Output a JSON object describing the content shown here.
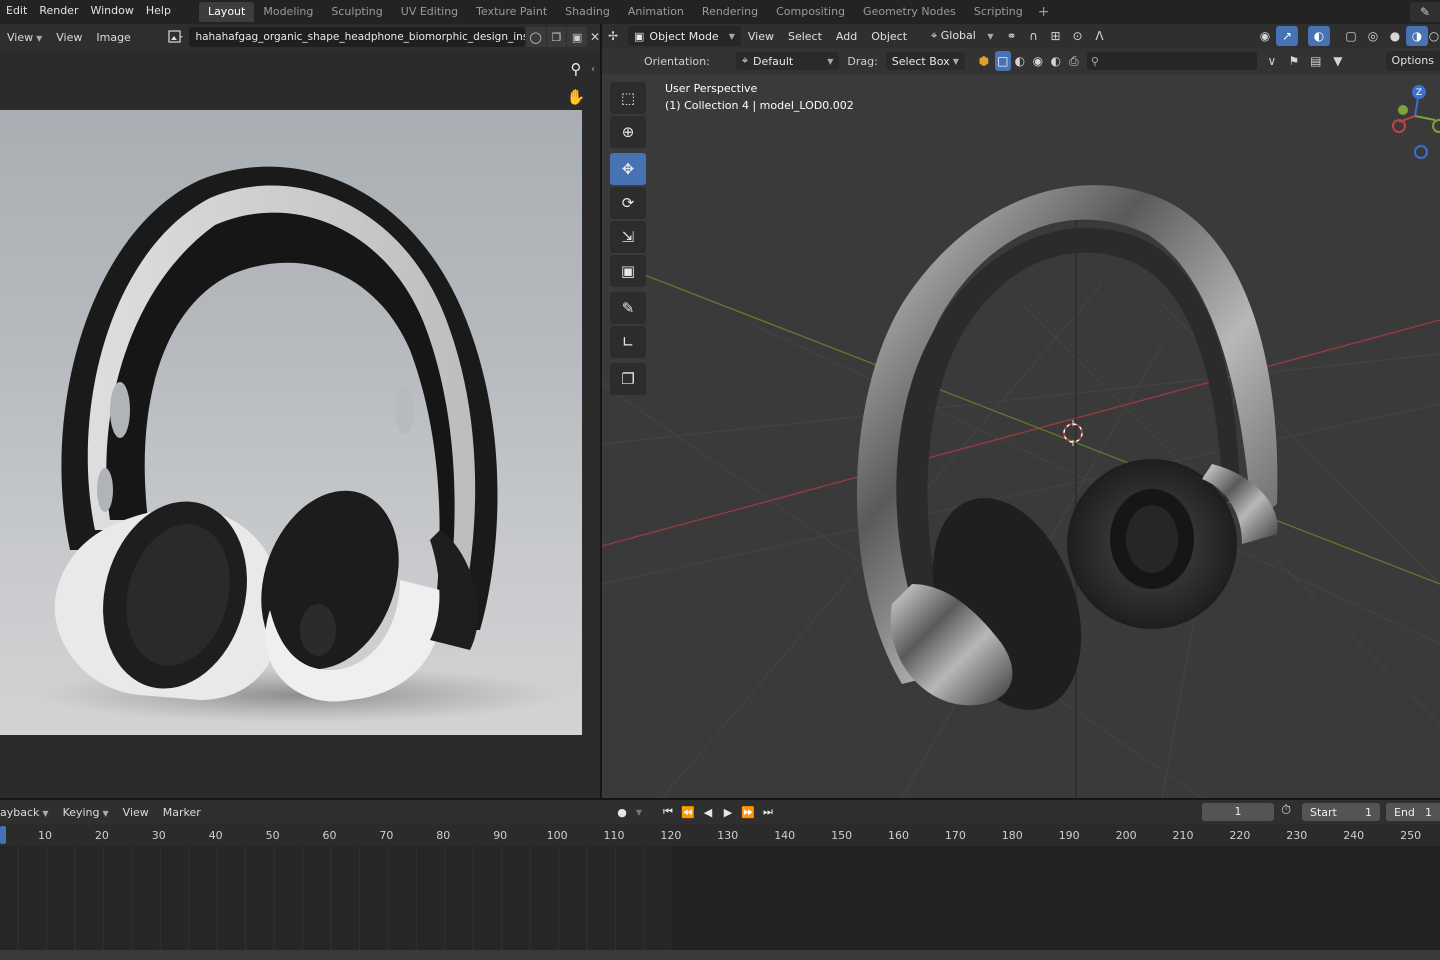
{
  "topbar": {
    "menu": [
      "Edit",
      "Render",
      "Window",
      "Help"
    ],
    "workspaces": [
      "Layout",
      "Modeling",
      "Sculpting",
      "UV Editing",
      "Texture Paint",
      "Shading",
      "Animation",
      "Rendering",
      "Compositing",
      "Geometry Nodes",
      "Scripting"
    ],
    "active_workspace": "Layout",
    "add_label": "+"
  },
  "image_editor": {
    "menus": [
      "View",
      "View",
      "Image"
    ],
    "filename": "hahahafgag_organic_shape_headphone_biomorphic_design_inspired_b"
  },
  "viewport": {
    "mode": "Object Mode",
    "menus": [
      "View",
      "Select",
      "Add",
      "Object"
    ],
    "transform_orientation": "Global",
    "tool_settings": {
      "orientation_label": "Orientation:",
      "orientation_value": "Default",
      "drag_label": "Drag:",
      "drag_value": "Select Box",
      "options_label": "Options"
    },
    "view_name": "User Perspective",
    "collection_info": "(1) Collection 4 | model_LOD0.002",
    "gizmo_axis": "Z"
  },
  "timeline": {
    "menus": [
      "ayback",
      "Keying",
      "View",
      "Marker"
    ],
    "current_frame": "1",
    "start_label": "Start",
    "start_value": "1",
    "end_label": "End",
    "end_value": "1",
    "ticks": [
      "10",
      "20",
      "30",
      "40",
      "50",
      "60",
      "70",
      "80",
      "90",
      "100",
      "110",
      "120",
      "130",
      "140",
      "150",
      "160",
      "170",
      "180",
      "190",
      "200",
      "210",
      "220",
      "230",
      "240",
      "250"
    ]
  },
  "colors": {
    "accent": "#4772b3",
    "x_axis": "#c2414b",
    "y_axis": "#7ea33a",
    "z_axis": "#3b6fd1"
  }
}
